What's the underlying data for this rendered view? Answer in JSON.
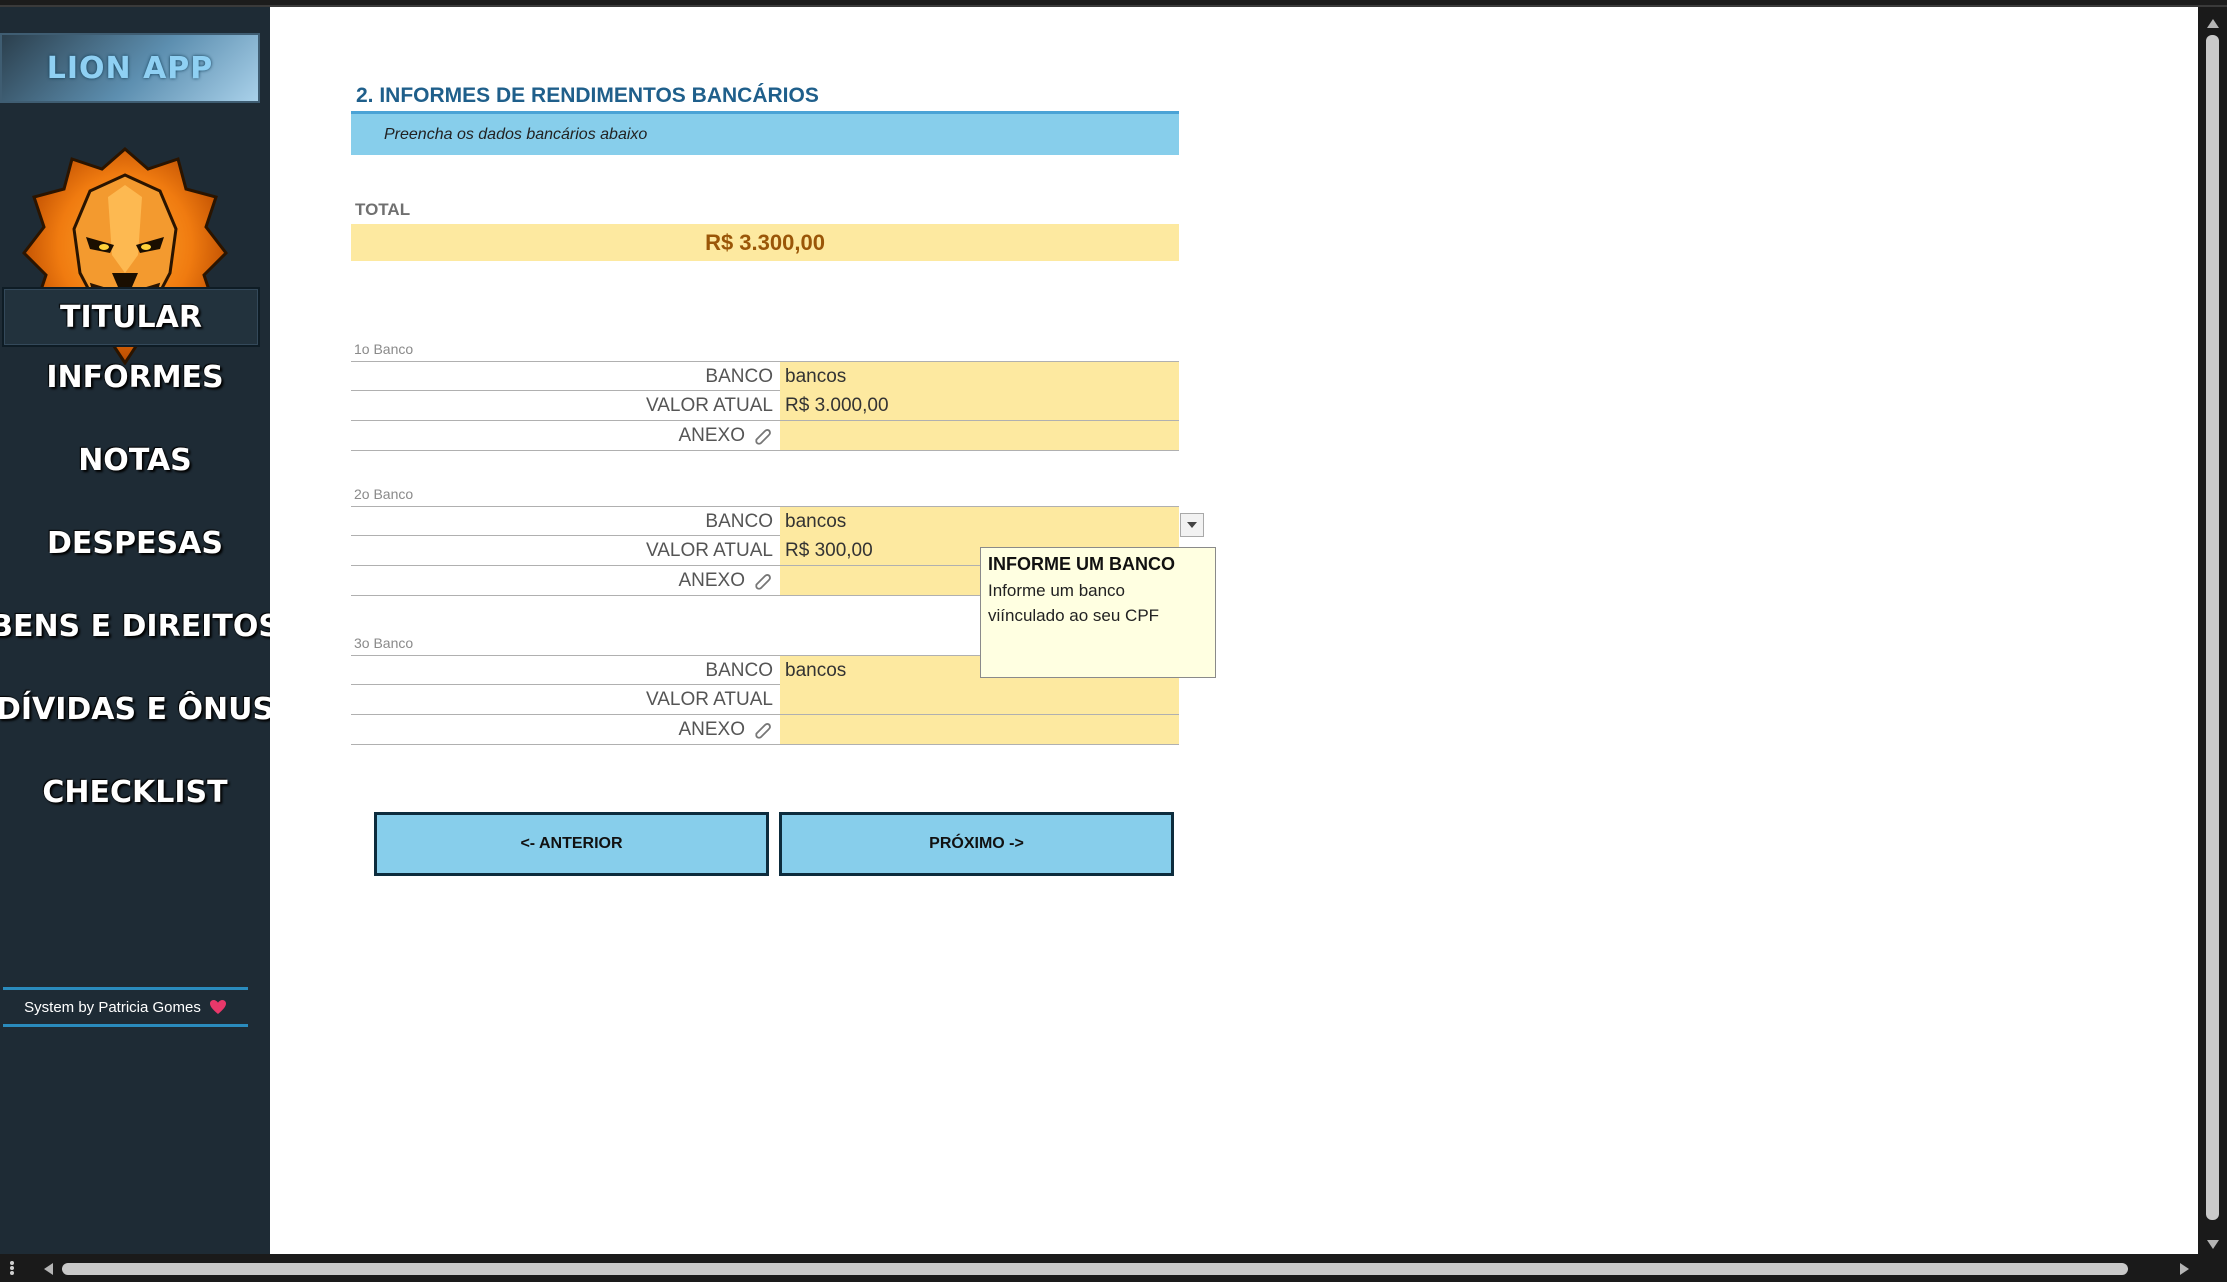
{
  "sidebar": {
    "app_title": "LION APP",
    "nav": [
      {
        "label": "TITULAR",
        "active": true
      },
      {
        "label": "INFORMES",
        "active": false
      },
      {
        "label": "NOTAS",
        "active": false
      },
      {
        "label": "DESPESAS",
        "active": false
      },
      {
        "label": "BENS E DIREITOS",
        "active": false
      },
      {
        "label": "DÍVIDAS E ÔNUS",
        "active": false
      },
      {
        "label": "CHECKLIST",
        "active": false
      }
    ],
    "credit": "System by Patricia Gomes",
    "credit_icon": "heart-icon",
    "logo_icon": "lion-logo"
  },
  "main": {
    "section_title": "2. INFORMES DE RENDIMENTOS BANCÁRIOS",
    "subtitle": "Preencha os dados bancários abaixo",
    "total_label": "TOTAL",
    "total_value": "R$ 3.300,00",
    "banks": [
      {
        "header": "1o Banco",
        "banco_label": "BANCO",
        "banco_value": "bancos",
        "valor_label": "VALOR ATUAL",
        "valor_value": "R$ 3.000,00",
        "anexo_label": "ANEXO",
        "anexo_value": ""
      },
      {
        "header": "2o Banco",
        "banco_label": "BANCO",
        "banco_value": "bancos",
        "valor_label": "VALOR ATUAL",
        "valor_value": "R$ 300,00",
        "anexo_label": "ANEXO",
        "anexo_value": ""
      },
      {
        "header": "3o Banco",
        "banco_label": "BANCO",
        "banco_value": "bancos",
        "valor_label": "VALOR ATUAL",
        "valor_value": "",
        "anexo_label": "ANEXO",
        "anexo_value": ""
      }
    ],
    "tooltip": {
      "title": "INFORME UM BANCO",
      "body": "Informe um banco viínculado ao seu CPF"
    },
    "buttons": {
      "prev": "<- ANTERIOR",
      "next": "PRÓXIMO ->"
    }
  },
  "colors": {
    "sidebar_bg": "#1e2b35",
    "input_fill": "#fde9a0",
    "header_blue": "#87ceeb",
    "title_text": "#1f5f8b",
    "total_text": "#9a5608"
  }
}
